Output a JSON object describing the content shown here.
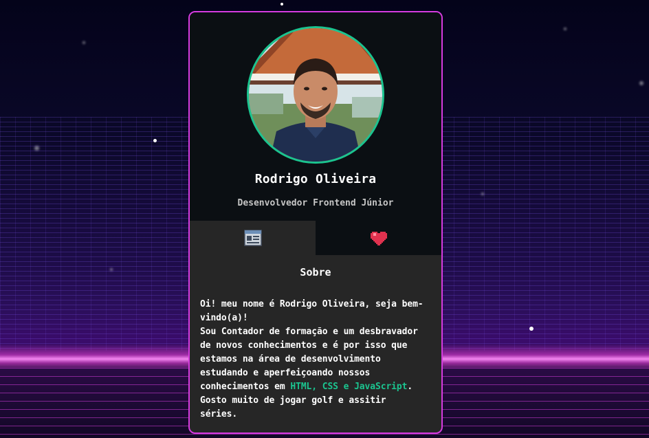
{
  "profile": {
    "name": "Rodrigo Oliveira",
    "role": "Desenvolvedor Frontend Júnior"
  },
  "tabs": [
    {
      "icon": "about-document-icon",
      "active": true
    },
    {
      "icon": "heart-icon",
      "active": false
    }
  ],
  "about": {
    "title": "Sobre",
    "intro": "Oi! meu nome é Rodrigo Oliveira, seja bem-vindo(a)!",
    "body_before": "Sou Contador de formação e um desbravador de novos conhecimentos e é por isso que estamos na área de desenvolvimento estudando e aperfeiçoando nossos conhecimentos em ",
    "highlight": "HTML, CSS e JavaScript",
    "body_after": ". Gosto muito de jogar golf e assitir séries."
  },
  "colors": {
    "card_border": "#d63be0",
    "accent": "#1bc48f",
    "card_top": "#0b0f13",
    "card_body": "#262626"
  }
}
